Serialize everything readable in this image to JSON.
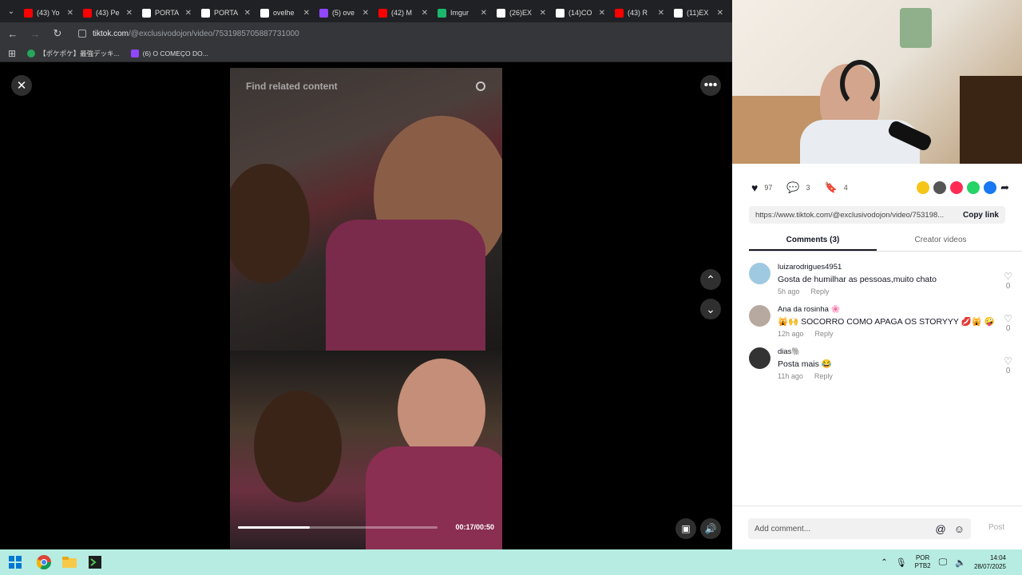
{
  "browser": {
    "tabs": [
      {
        "label": "(43) Yo",
        "icon": "youtube-icon",
        "color": "#ff0000"
      },
      {
        "label": "(43) Pe",
        "icon": "youtube-icon",
        "color": "#ff0000"
      },
      {
        "label": "PORTA",
        "icon": "x-logo-icon",
        "color": "#ffffff"
      },
      {
        "label": "PORTA",
        "icon": "x-logo-icon",
        "color": "#ffffff"
      },
      {
        "label": "ovelhe",
        "icon": "x-logo-icon",
        "color": "#ffffff"
      },
      {
        "label": "(5) ove",
        "icon": "twitch-icon",
        "color": "#9146ff"
      },
      {
        "label": "(42) M",
        "icon": "youtube-icon",
        "color": "#ff0000"
      },
      {
        "label": "Imgur",
        "icon": "imgur-icon",
        "color": "#1bb76e"
      },
      {
        "label": "(26)EX",
        "icon": "tiktok-icon",
        "color": "#ffffff"
      },
      {
        "label": "(14)CO",
        "icon": "tiktok-icon",
        "color": "#ffffff"
      },
      {
        "label": "(43) R",
        "icon": "youtube-icon",
        "color": "#ff0000"
      },
      {
        "label": "(11)EX",
        "icon": "tiktok-icon",
        "color": "#ffffff"
      }
    ],
    "url_domain": "tiktok.com",
    "url_path": "/@exclusivodojon/video/7531985705887731000",
    "bookmarks": [
      {
        "label": "【ポケポケ】最強デッキ...",
        "color": "#26a65b"
      },
      {
        "label": "(6) O COMEÇO DO...",
        "color": "#9146ff"
      }
    ]
  },
  "video": {
    "search_placeholder": "Find related content",
    "timecode": "00:17/00:50",
    "progress": 0.36
  },
  "panel": {
    "likes": "97",
    "comments_count": "3",
    "saves": "4",
    "share_link": "https://www.tiktok.com/@exclusivodojon/video/753198...",
    "copy_label": "Copy link",
    "tab_comments": "Comments (3)",
    "tab_creator": "Creator videos",
    "comments": [
      {
        "name": "luizarodrigues4951",
        "text": "Gosta de humilhar as pessoas,muito chato",
        "time": "5h ago",
        "reply": "Reply",
        "likes": "0",
        "avatar_color": "#9fc9e0"
      },
      {
        "name": "Ana da rosinha 🌸",
        "text": "🙀🙌 SOCORRO COMO APAGA OS STORYYY 💋🙀 🤪",
        "time": "12h ago",
        "reply": "Reply",
        "likes": "0",
        "avatar_color": "#b8a9a0"
      },
      {
        "name": "dias🐘",
        "text": "Posta mais 😂",
        "time": "11h ago",
        "reply": "Reply",
        "likes": "0",
        "avatar_color": "#333333"
      }
    ],
    "add_placeholder": "Add comment...",
    "post_label": "Post"
  },
  "taskbar": {
    "lang_top": "POR",
    "lang_bottom": "PTB2",
    "time": "14:04",
    "date": "28/07/2025"
  }
}
